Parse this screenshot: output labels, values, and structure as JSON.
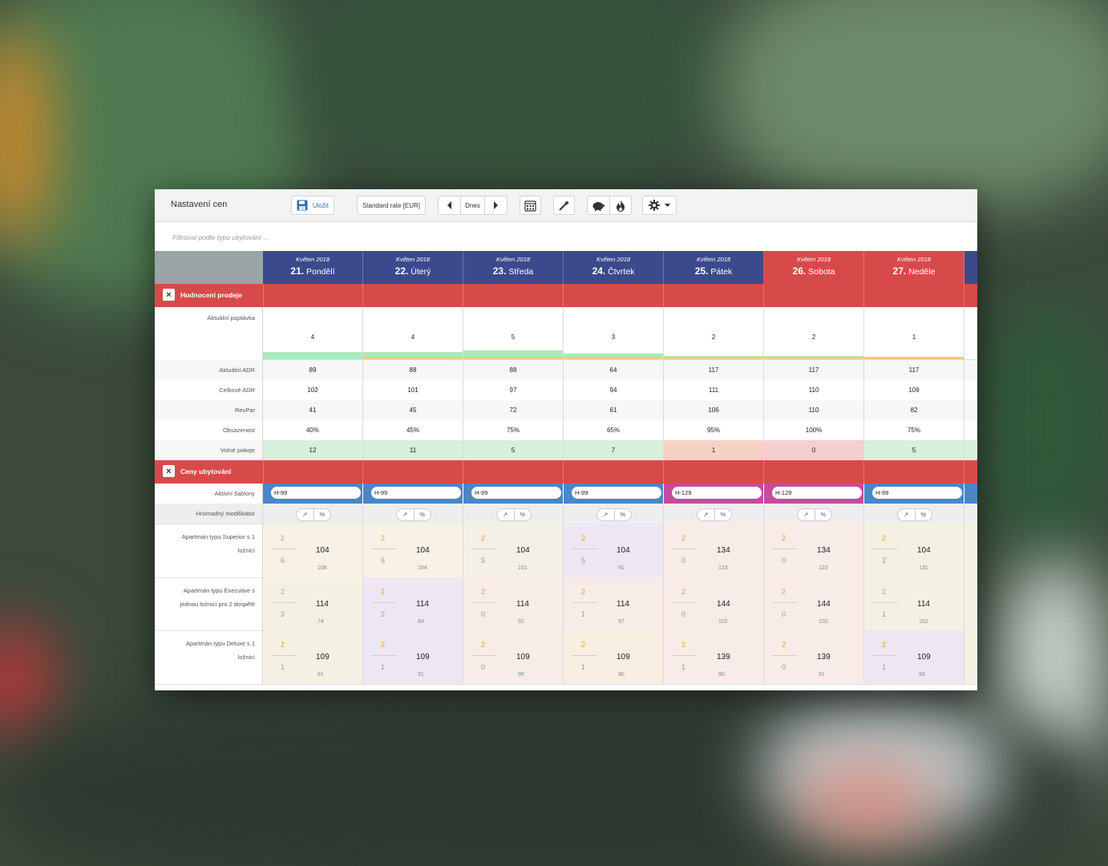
{
  "toolbar": {
    "title": "Nastavení cen",
    "save_label": "Uložit",
    "rate_label": "Standard rate [EUR]",
    "today_label": "Dnes"
  },
  "filter": {
    "placeholder": "Filtrovat podle typu ubytování ..."
  },
  "days": [
    {
      "month": "Květen 2018",
      "num": "21.",
      "name": "Pondělí",
      "weekend": false
    },
    {
      "month": "Květen 2018",
      "num": "22.",
      "name": "Úterý",
      "weekend": false
    },
    {
      "month": "Květen 2018",
      "num": "23.",
      "name": "Středa",
      "weekend": false
    },
    {
      "month": "Květen 2018",
      "num": "24.",
      "name": "Čtvrtek",
      "weekend": false
    },
    {
      "month": "Květen 2018",
      "num": "25.",
      "name": "Pátek",
      "weekend": false
    },
    {
      "month": "Květen 2018",
      "num": "26.",
      "name": "Sobota",
      "weekend": true
    },
    {
      "month": "Květen 2018",
      "num": "27.",
      "name": "Neděle",
      "weekend": true
    }
  ],
  "colors": {
    "weekday_header": "#3a4a8c",
    "weekend_header": "#d84a4a",
    "section": "#d84a4a",
    "template_blue": "#4a86c8",
    "template_pink": "#c84a9a"
  },
  "section_sales": {
    "title": "Hodnocení prodeje",
    "demand_label": "Aktuální poptávka",
    "demand": [
      "4",
      "4",
      "5",
      "3",
      "2",
      "2",
      "1"
    ],
    "demand_level": [
      0.4,
      0.4,
      0.5,
      0.3,
      0.2,
      0.2,
      0.1
    ],
    "stats": [
      {
        "label": "Aktuální ADR",
        "values": [
          "89",
          "88",
          "88",
          "64",
          "117",
          "117",
          "117"
        ]
      },
      {
        "label": "Celkové ADR",
        "values": [
          "102",
          "101",
          "97",
          "94",
          "111",
          "110",
          "109"
        ]
      },
      {
        "label": "RevPar",
        "values": [
          "41",
          "45",
          "72",
          "61",
          "106",
          "110",
          "82"
        ]
      },
      {
        "label": "Obsazenost",
        "values": [
          "40%",
          "45%",
          "75%",
          "65%",
          "95%",
          "100%",
          "75%"
        ]
      }
    ],
    "free_label": "Volné pokoje",
    "free": [
      "12",
      "11",
      "5",
      "7",
      "1",
      "0",
      "5"
    ],
    "free_colors": [
      "#d5f0dc",
      "#d5f0dc",
      "#d5f0dc",
      "#d5f0dc",
      "#f6d2c4",
      "#f6cfcf",
      "#d5f0dc"
    ]
  },
  "section_prices": {
    "title": "Ceny ubytování",
    "templates_label": "Aktivní šablony",
    "templates": [
      "H-99",
      "H-99",
      "H-99",
      "H-99",
      "H-129",
      "H-129",
      "H-99"
    ],
    "template_colors": [
      "#4a86c8",
      "#4a86c8",
      "#4a86c8",
      "#4a86c8",
      "#c84a9a",
      "#c84a9a",
      "#4a86c8"
    ],
    "modifier_label": "Hromadný modifikátor",
    "modifier_unit": "%",
    "rooms": [
      {
        "name": "Apartmán typu Superior s 1 ložnicí",
        "cells": [
          {
            "avail": "2",
            "sold": "6",
            "price": "104",
            "sub": "108",
            "bg": "#f7f1e6"
          },
          {
            "avail": "2",
            "sold": "6",
            "price": "104",
            "sub": "104",
            "bg": "#f7f1e6"
          },
          {
            "avail": "2",
            "sold": "5",
            "price": "104",
            "sub": "101",
            "bg": "#f4f0e6"
          },
          {
            "avail": "2",
            "sold": "5",
            "price": "104",
            "sub": "91",
            "bg": "#efe6f4"
          },
          {
            "avail": "2",
            "sold": "0",
            "price": "134",
            "sub": "123",
            "bg": "#f8ece8"
          },
          {
            "avail": "2",
            "sold": "0",
            "price": "134",
            "sub": "123",
            "bg": "#f8ece8"
          },
          {
            "avail": "2",
            "sold": "2",
            "price": "104",
            "sub": "131",
            "bg": "#f4f1e4"
          }
        ]
      },
      {
        "name": "Apartmán typu Executive s jednou ložnicí pro 2 dospělé",
        "cells": [
          {
            "avail": "2",
            "sold": "3",
            "price": "114",
            "sub": "74",
            "bg": "#f4f1e4"
          },
          {
            "avail": "2",
            "sold": "2",
            "price": "114",
            "sub": "84",
            "bg": "#efe6f4"
          },
          {
            "avail": "2",
            "sold": "0",
            "price": "114",
            "sub": "91",
            "bg": "#f8ece8"
          },
          {
            "avail": "2",
            "sold": "1",
            "price": "114",
            "sub": "97",
            "bg": "#f8ece8"
          },
          {
            "avail": "2",
            "sold": "0",
            "price": "144",
            "sub": "102",
            "bg": "#f8ece8"
          },
          {
            "avail": "2",
            "sold": "0",
            "price": "144",
            "sub": "102",
            "bg": "#f8ece8"
          },
          {
            "avail": "2",
            "sold": "1",
            "price": "114",
            "sub": "102",
            "bg": "#f4f1e4"
          }
        ]
      },
      {
        "name": "Apartmán typu Deluxe s 1 ložnicí",
        "cells": [
          {
            "avail": "2",
            "sold": "1",
            "price": "109",
            "sub": "91",
            "bg": "#f4f1e4"
          },
          {
            "avail": "2",
            "sold": "1",
            "price": "109",
            "sub": "91",
            "bg": "#efe6f4"
          },
          {
            "avail": "2",
            "sold": "0",
            "price": "109",
            "sub": "90",
            "bg": "#f8ece8"
          },
          {
            "avail": "2",
            "sold": "1",
            "price": "109",
            "sub": "90",
            "bg": "#f8efe2"
          },
          {
            "avail": "2",
            "sold": "1",
            "price": "139",
            "sub": "90",
            "bg": "#f8ece8"
          },
          {
            "avail": "2",
            "sold": "0",
            "price": "139",
            "sub": "91",
            "bg": "#f8ece8"
          },
          {
            "avail": "2",
            "sold": "1",
            "price": "109",
            "sub": "93",
            "bg": "#efe6f4"
          }
        ]
      }
    ]
  }
}
